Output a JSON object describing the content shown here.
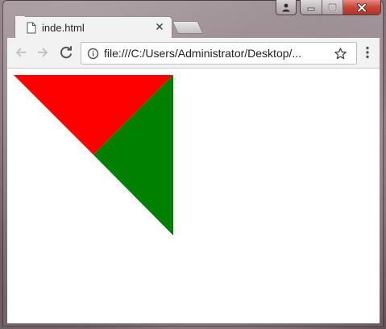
{
  "window": {
    "controls": [
      "user-icon",
      "minimize-icon",
      "maximize-icon",
      "close-icon"
    ]
  },
  "tab": {
    "title": "inde.html",
    "icon": "page-icon"
  },
  "toolbar": {
    "back_icon": "back-arrow-icon",
    "forward_icon": "forward-arrow-icon",
    "reload_icon": "reload-icon",
    "info_icon": "info-icon",
    "url": "file:///C:/Users/Administrator/Desktop/...",
    "bookmark_icon": "star-icon",
    "menu_icon": "more-vertical-icon"
  },
  "page": {
    "shapes": [
      {
        "shape": "triangle",
        "color": "#ff0000"
      },
      {
        "shape": "triangle",
        "color": "#008000"
      }
    ]
  }
}
